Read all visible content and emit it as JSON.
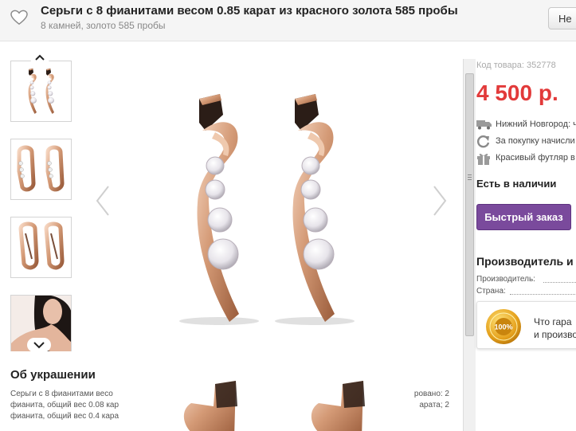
{
  "header": {
    "title": "Серьги с 8 фианитами весом 0.85 карат из красного золота 585 пробы",
    "subtitle": "8 камней, золото 585 пробы",
    "button_label": "Не"
  },
  "about": {
    "title": "Об украшении",
    "left_lines": [
      "Серьги с 8 фианитами весо",
      "фианита, общий вес 0.08 кар",
      "фианита, общий вес 0.4 кара"
    ],
    "right_lines": [
      "ровано: 2",
      "арата; 2",
      ""
    ]
  },
  "product": {
    "sku": "Код товара: 352778",
    "price": "4 500 р.",
    "delivery": "Нижний Новгород: ч",
    "bonus": "За покупку начисли",
    "gift": "Красивый футляр в",
    "stock": "Есть в наличии",
    "quick_order": "Быстрый заказ"
  },
  "manufacturer": {
    "title": "Производитель и",
    "maker_label": "Производитель:",
    "country_label": "Страна:"
  },
  "guarantee": {
    "badge_text": "100%",
    "line1": "Что гара",
    "line2": "и произво"
  },
  "colors": {
    "price": "#e23a3a",
    "quick_button": "#7a4a9c",
    "gold": "#c98a63"
  },
  "icons": [
    "heart-icon",
    "chevron-up-icon",
    "chevron-down-icon",
    "chevron-left-icon",
    "chevron-right-icon",
    "truck-icon",
    "refresh-icon",
    "gift-icon",
    "guarantee-badge-icon"
  ]
}
